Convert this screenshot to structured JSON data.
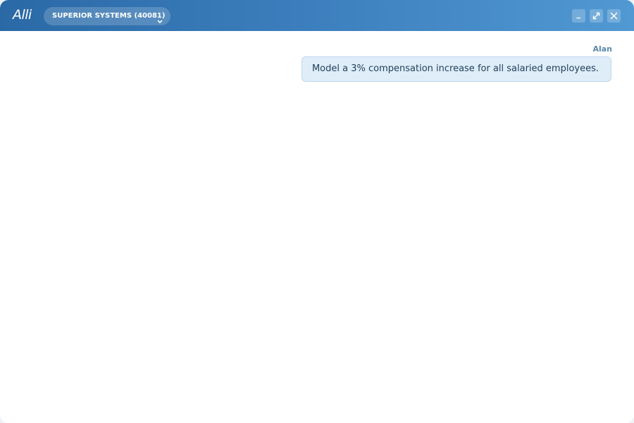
{
  "app": {
    "logo_text": "Alli"
  },
  "header": {
    "company_selector": {
      "label": "SUPERIOR SYSTEMS (40081)",
      "icon": "chevron-down-icon"
    },
    "window_controls": {
      "minimize_icon": "minimize-icon",
      "maximize_icon": "expand-icon",
      "close_icon": "close-icon"
    }
  },
  "chat": {
    "messages": [
      {
        "sender": "Alan",
        "text": "Model a 3% compensation increase for all salaried employees."
      }
    ]
  },
  "colors": {
    "header_start": "#2a69a6",
    "header_end": "#5199d3",
    "bubble_bg": "#dfedf8",
    "bubble_border": "#bdd8ee",
    "sender_name": "#5d87ad",
    "message_text": "#1f3f5c"
  }
}
